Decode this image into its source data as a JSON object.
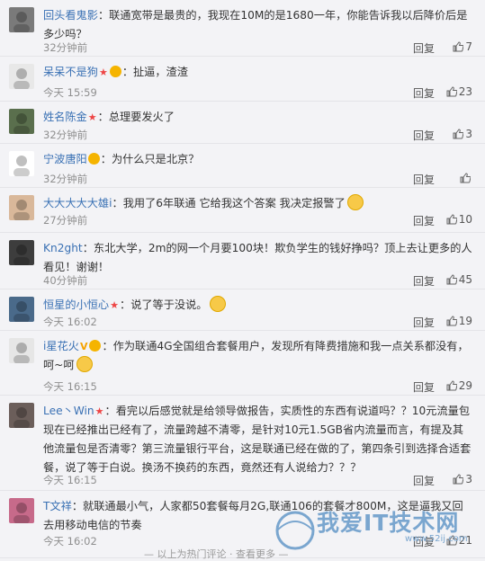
{
  "reply_label": "回复",
  "comments": [
    {
      "username": "回头看鬼影",
      "badges": [],
      "text": "联通宽带是最贵的，我现在10M的是1680一年，你能告诉我以后降价后是多少吗？",
      "time": "32分钟前",
      "likes": "7",
      "avatar_color": "#7a7a7a"
    },
    {
      "username": "呆呆不是狗",
      "badges": [
        "star",
        "gold"
      ],
      "text": "扯逼，渣渣",
      "time": "今天 15:59",
      "likes": "23",
      "avatar_color": "#e8e8e8"
    },
    {
      "username": "姓名陈金",
      "badges": [
        "star"
      ],
      "text": "总理要发火了",
      "time": "32分钟前",
      "likes": "3",
      "avatar_color": "#5a6f4d"
    },
    {
      "username": "宁波唐阳",
      "badges": [
        "gold"
      ],
      "text": "为什么只是北京？",
      "time": "32分钟前",
      "likes": "",
      "avatar_color": "#ffffff"
    },
    {
      "username": "大大大大大雄i",
      "badges": [],
      "text": "我用了6年联通 它给我这个答案 我决定报警了",
      "time": "27分钟前",
      "likes": "10",
      "avatar_color": "#d9b89a"
    },
    {
      "username": "Kn2ght",
      "badges": [],
      "text": "东北大学，2m的网一个月要100块！欺负学生的钱好挣吗？顶上去让更多的人看见！谢谢！",
      "time": "40分钟前",
      "likes": "45",
      "avatar_color": "#3d3d3d"
    },
    {
      "username": "恒星的小恒心",
      "badges": [
        "star"
      ],
      "text": "说了等于没说。",
      "time": "今天 16:02",
      "likes": "19",
      "avatar_color": "#4a6a8a"
    },
    {
      "username": "i星花火",
      "badges": [
        "v",
        "gold"
      ],
      "text": "作为联通4G全国组合套餐用户，发现所有降费措施和我一点关系都没有，呵~呵",
      "time": "今天 16:15",
      "likes": "29",
      "avatar_color": "#e6e6e6"
    },
    {
      "username": "Lee丶Win",
      "badges": [
        "star"
      ],
      "text": "看完以后感觉就是给领导做报告，实质性的东西有说道吗？？10元流量包现在已经推出已经有了，流量跨越不清零，是针对10元1.5GB省内流量而言，有提及其他流量包是否清零？第三流量银行平台，这是联通已经在做的了，第四条引到选择合适套餐，说了等于白说。换汤不换药的东西，竟然还有人说给力？？？",
      "time": "今天 16:15",
      "likes": "3",
      "avatar_color": "#6b5e5a"
    },
    {
      "username": "T文祥",
      "badges": [],
      "text": "就联通最小气，人家都50套餐每月2G,联通106的套餐才800M，这是逼我又回去用移动电信的节奏",
      "time": "今天 16:02",
      "likes": "21",
      "avatar_color": "#c76a8a"
    }
  ],
  "footer_text": "— 以上为热门评论 · 查看更多 —",
  "watermark": {
    "title": "我爱IT技术网",
    "url": "www.52ij.com"
  }
}
